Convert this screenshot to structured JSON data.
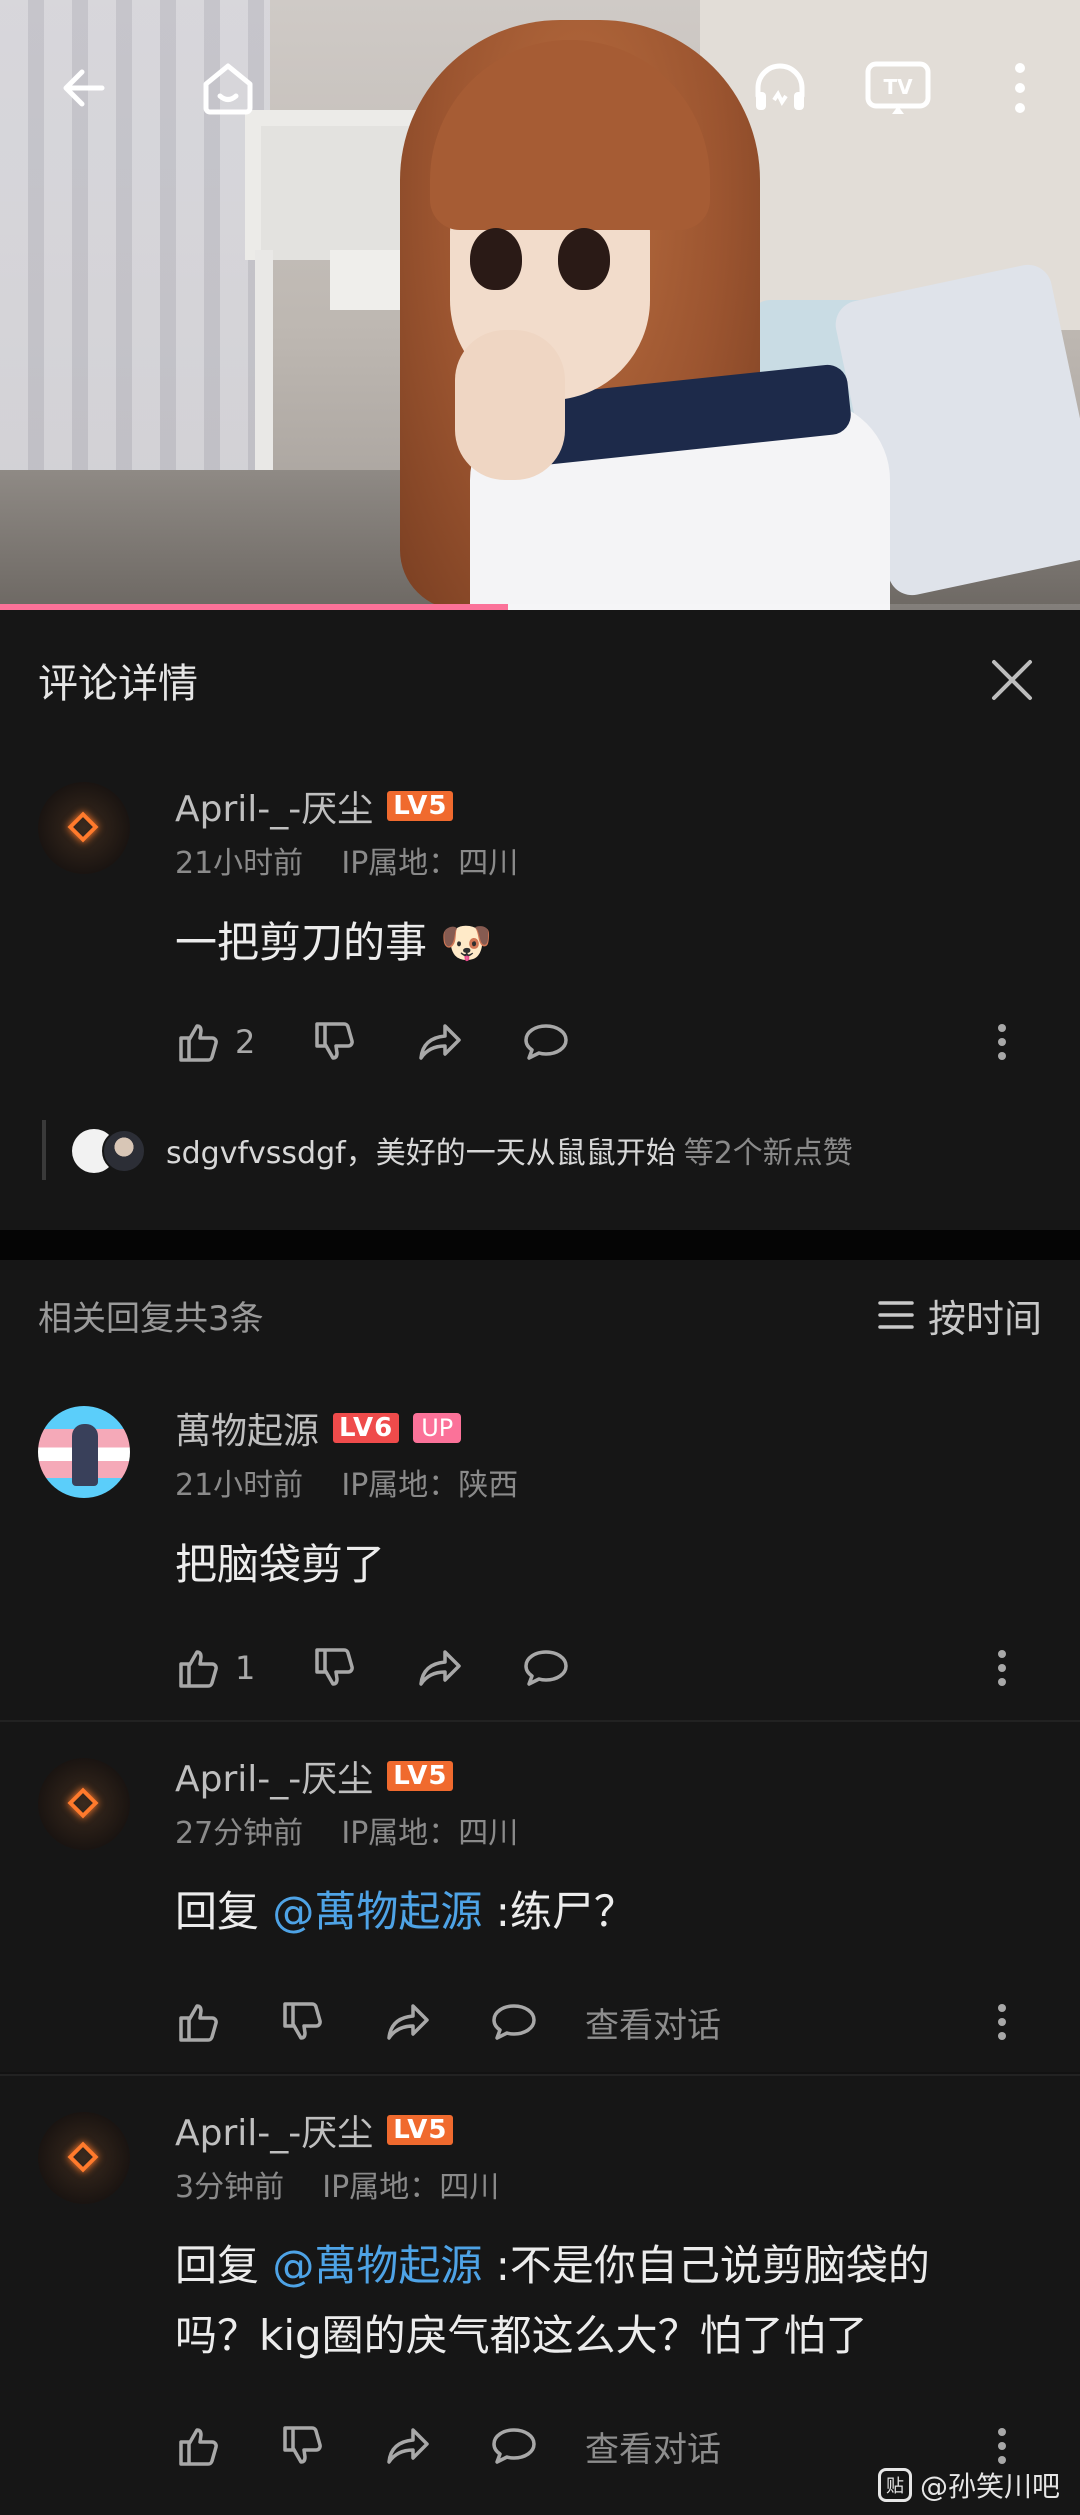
{
  "video": {
    "progress": 0.47,
    "icons": [
      "back-arrow-icon",
      "home-icon",
      "headphones-icon",
      "tv-cast-icon",
      "more-vertical-icon"
    ],
    "tv_label": "TV"
  },
  "panel": {
    "title": "评论详情"
  },
  "main_comment": {
    "username": "April-_-厌尘",
    "level": "LV5",
    "time": "21小时前",
    "ip": "IP属地：四川",
    "text": "一把剪刀的事",
    "emoji": "🐶",
    "likes": "2",
    "likers": {
      "names": "sdgvfvssdgf，美好的一天从鼠鼠开始",
      "extra": "等2个新点赞"
    }
  },
  "replies_header": {
    "count_label": "相关回复共3条",
    "sort_label": "按时间"
  },
  "replies": [
    {
      "username": "萬物起源",
      "level": "LV6",
      "badge": "UP",
      "time": "21小时前",
      "ip": "IP属地：陕西",
      "text": "把脑袋剪了",
      "likes": "1"
    },
    {
      "username": "April-_-厌尘",
      "level": "LV5",
      "time": "27分钟前",
      "ip": "IP属地：四川",
      "reply_prefix": "回复 ",
      "mention": "@萬物起源",
      "text": " :练尸？",
      "view_conversation": "查看对话"
    },
    {
      "username": "April-_-厌尘",
      "level": "LV5",
      "time": "3分钟前",
      "ip": "IP属地：四川",
      "reply_prefix": "回复 ",
      "mention": "@萬物起源",
      "text": " :不是你自己说剪脑袋的吗？kig圈的戾气都这么大？怕了怕了",
      "view_conversation": "查看对话"
    }
  ],
  "watermark": {
    "icon_label": "贴",
    "text": "@孙笑川吧"
  },
  "colors": {
    "accent_pink": "#fb7299",
    "mention_blue": "#4ea3e6",
    "level_orange": "#f06a2e"
  }
}
